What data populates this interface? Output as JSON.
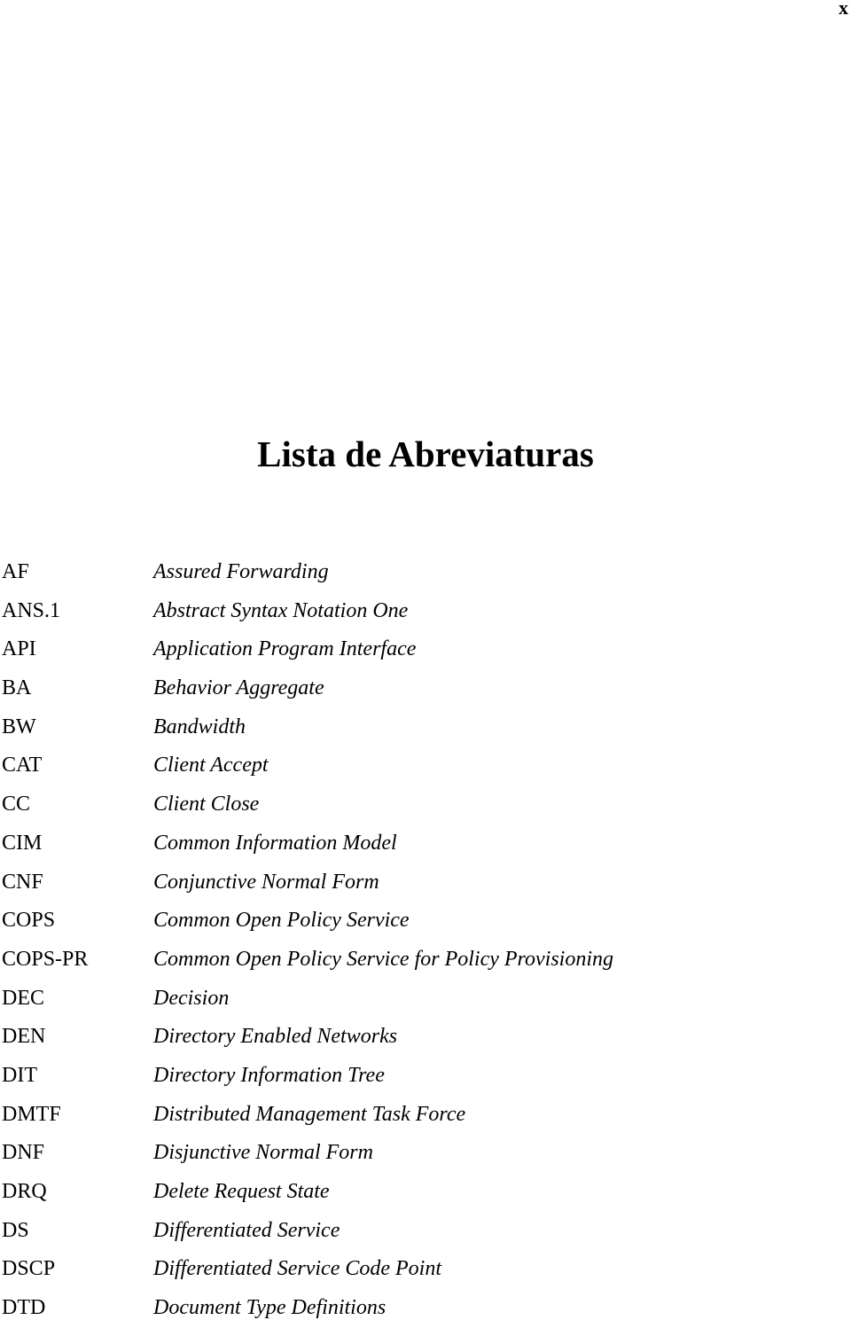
{
  "page": {
    "number": "x",
    "title": "Lista de Abreviaturas"
  },
  "abbreviations": [
    {
      "term": "AF",
      "definition": "Assured Forwarding"
    },
    {
      "term": "ANS.1",
      "definition": "Abstract Syntax Notation One"
    },
    {
      "term": "API",
      "definition": "Application Program Interface"
    },
    {
      "term": "BA",
      "definition": "Behavior Aggregate"
    },
    {
      "term": "BW",
      "definition": "Bandwidth"
    },
    {
      "term": "CAT",
      "definition": "Client Accept"
    },
    {
      "term": "CC",
      "definition": "Client Close"
    },
    {
      "term": "CIM",
      "definition": "Common Information Model"
    },
    {
      "term": "CNF",
      "definition": "Conjunctive Normal Form"
    },
    {
      "term": "COPS",
      "definition": "Common Open Policy Service"
    },
    {
      "term": "COPS-PR",
      "definition": "Common Open Policy Service for Policy Provisioning"
    },
    {
      "term": "DEC",
      "definition": "Decision"
    },
    {
      "term": "DEN",
      "definition": "Directory Enabled Networks"
    },
    {
      "term": "DIT",
      "definition": "Directory Information Tree"
    },
    {
      "term": "DMTF",
      "definition": "Distributed Management Task Force"
    },
    {
      "term": "DNF",
      "definition": "Disjunctive Normal Form"
    },
    {
      "term": "DRQ",
      "definition": "Delete Request State"
    },
    {
      "term": "DS",
      "definition": "Differentiated Service"
    },
    {
      "term": "DSCP",
      "definition": "Differentiated Service Code Point"
    },
    {
      "term": "DTD",
      "definition": "Document Type Definitions"
    }
  ]
}
